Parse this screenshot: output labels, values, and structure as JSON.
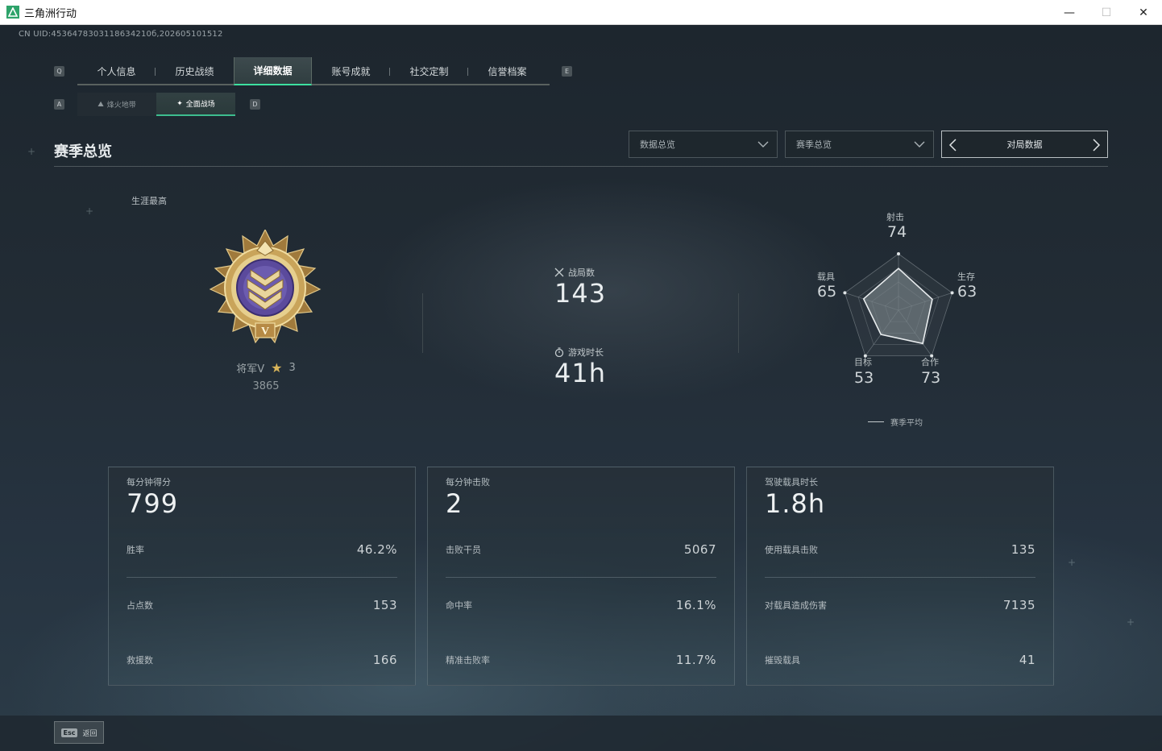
{
  "window": {
    "title": "三角洲行动",
    "minimize": "—",
    "maximize": "☐",
    "close": "✕"
  },
  "uid": "CN UID:4536478303118634210б,202605101512",
  "keys": {
    "prev_tab": "Q",
    "next_tab": "E",
    "prev_subtab": "A",
    "next_subtab": "D"
  },
  "tabs": [
    {
      "label": "个人信息",
      "active": false
    },
    {
      "label": "历史战绩",
      "active": false
    },
    {
      "label": "详细数据",
      "active": true
    },
    {
      "label": "账号成就",
      "active": false
    },
    {
      "label": "社交定制",
      "active": false
    },
    {
      "label": "信誉档案",
      "active": false
    }
  ],
  "subtabs": [
    {
      "label": "烽火地带",
      "icon": "fire-zone-icon",
      "active": false
    },
    {
      "label": "全面战场",
      "icon": "battlefield-icon",
      "active": true
    }
  ],
  "section": {
    "title": "赛季总览",
    "dropdown_data": "数据总览",
    "dropdown_season": "赛季总览",
    "pager_label": "对局数据"
  },
  "rank": {
    "career_label": "生涯最高",
    "name": "将军V",
    "stars": "3",
    "score": "3865"
  },
  "summary": {
    "matches_label": "战局数",
    "matches_value": "143",
    "playtime_label": "游戏时长",
    "playtime_value": "41h"
  },
  "radar": {
    "axes": [
      {
        "label": "射击",
        "value": "74",
        "score": 74
      },
      {
        "label": "生存",
        "value": "63",
        "score": 63
      },
      {
        "label": "合作",
        "value": "73",
        "score": 73
      },
      {
        "label": "目标",
        "value": "53",
        "score": 53
      },
      {
        "label": "载具",
        "value": "65",
        "score": 65
      }
    ],
    "legend": "赛季平均"
  },
  "cards": [
    {
      "title": "每分钟得分",
      "big": "799",
      "rows": [
        {
          "k": "胜率",
          "v": "46.2%"
        },
        {
          "k": "占点数",
          "v": "153"
        },
        {
          "k": "救援数",
          "v": "166"
        }
      ]
    },
    {
      "title": "每分钟击败",
      "big": "2",
      "rows": [
        {
          "k": "击败干员",
          "v": "5067"
        },
        {
          "k": "命中率",
          "v": "16.1%"
        },
        {
          "k": "精准击败率",
          "v": "11.7%"
        }
      ]
    },
    {
      "title": "驾驶载具时长",
      "big": "1.8h",
      "rows": [
        {
          "k": "使用载具击败",
          "v": "135"
        },
        {
          "k": "对载具造成伤害",
          "v": "7135"
        },
        {
          "k": "摧毁载具",
          "v": "41"
        }
      ]
    }
  ],
  "footer": {
    "esc_key": "Esc",
    "esc_label": "返回"
  },
  "colors": {
    "accent": "#3de0a0",
    "badge_gold": "#c9a45a",
    "badge_purple": "#5b4a9c"
  }
}
